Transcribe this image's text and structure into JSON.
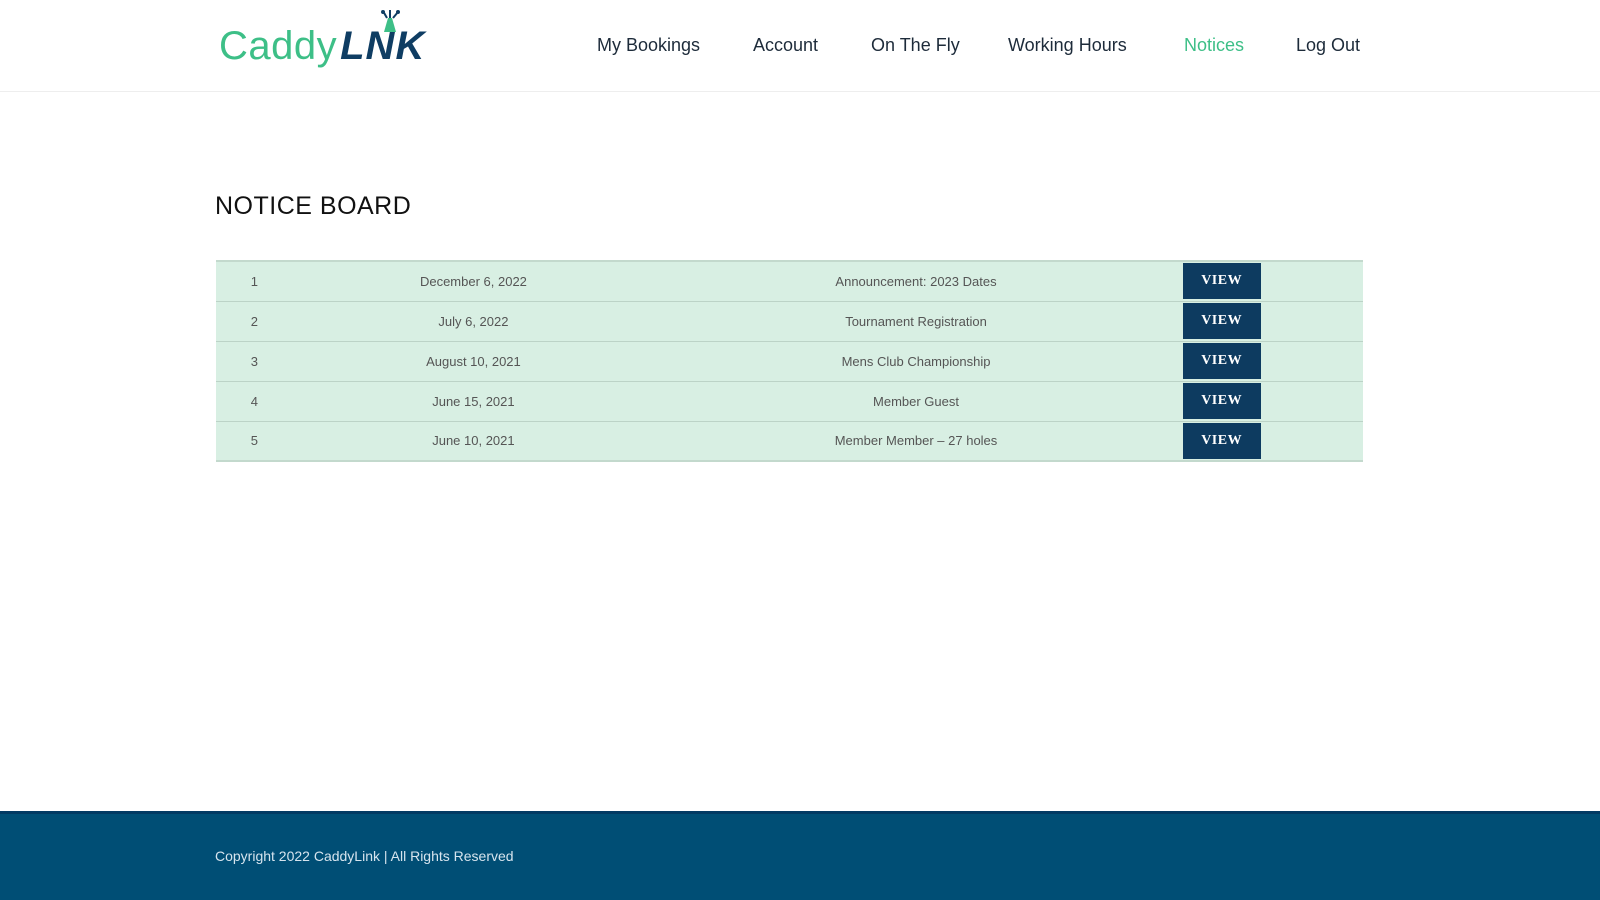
{
  "brand": {
    "name_part1": "Caddy",
    "name_part2": "LNK",
    "primary_color": "#3dbf87",
    "secondary_color": "#0f3d63"
  },
  "nav": {
    "items": [
      {
        "label": "My Bookings"
      },
      {
        "label": "Account"
      },
      {
        "label": "On The Fly"
      },
      {
        "label": "Working Hours"
      },
      {
        "label": "Notices",
        "active": true
      },
      {
        "label": "Log Out"
      }
    ]
  },
  "page": {
    "title": "NOTICE BOARD"
  },
  "notices": {
    "button_label": "VIEW",
    "rows": [
      {
        "number": "1",
        "date": "December 6, 2022",
        "title": "Announcement: 2023 Dates"
      },
      {
        "number": "2",
        "date": "July 6, 2022",
        "title": "Tournament Registration"
      },
      {
        "number": "3",
        "date": "August 10, 2021",
        "title": "Mens Club Championship"
      },
      {
        "number": "4",
        "date": "June 15, 2021",
        "title": "Member Guest"
      },
      {
        "number": "5",
        "date": "June 10, 2021",
        "title": "Member Member – 27 holes"
      }
    ]
  },
  "footer": {
    "copyright": "Copyright 2022 CaddyLink | All Rights Reserved",
    "background_color": "#004e75"
  }
}
